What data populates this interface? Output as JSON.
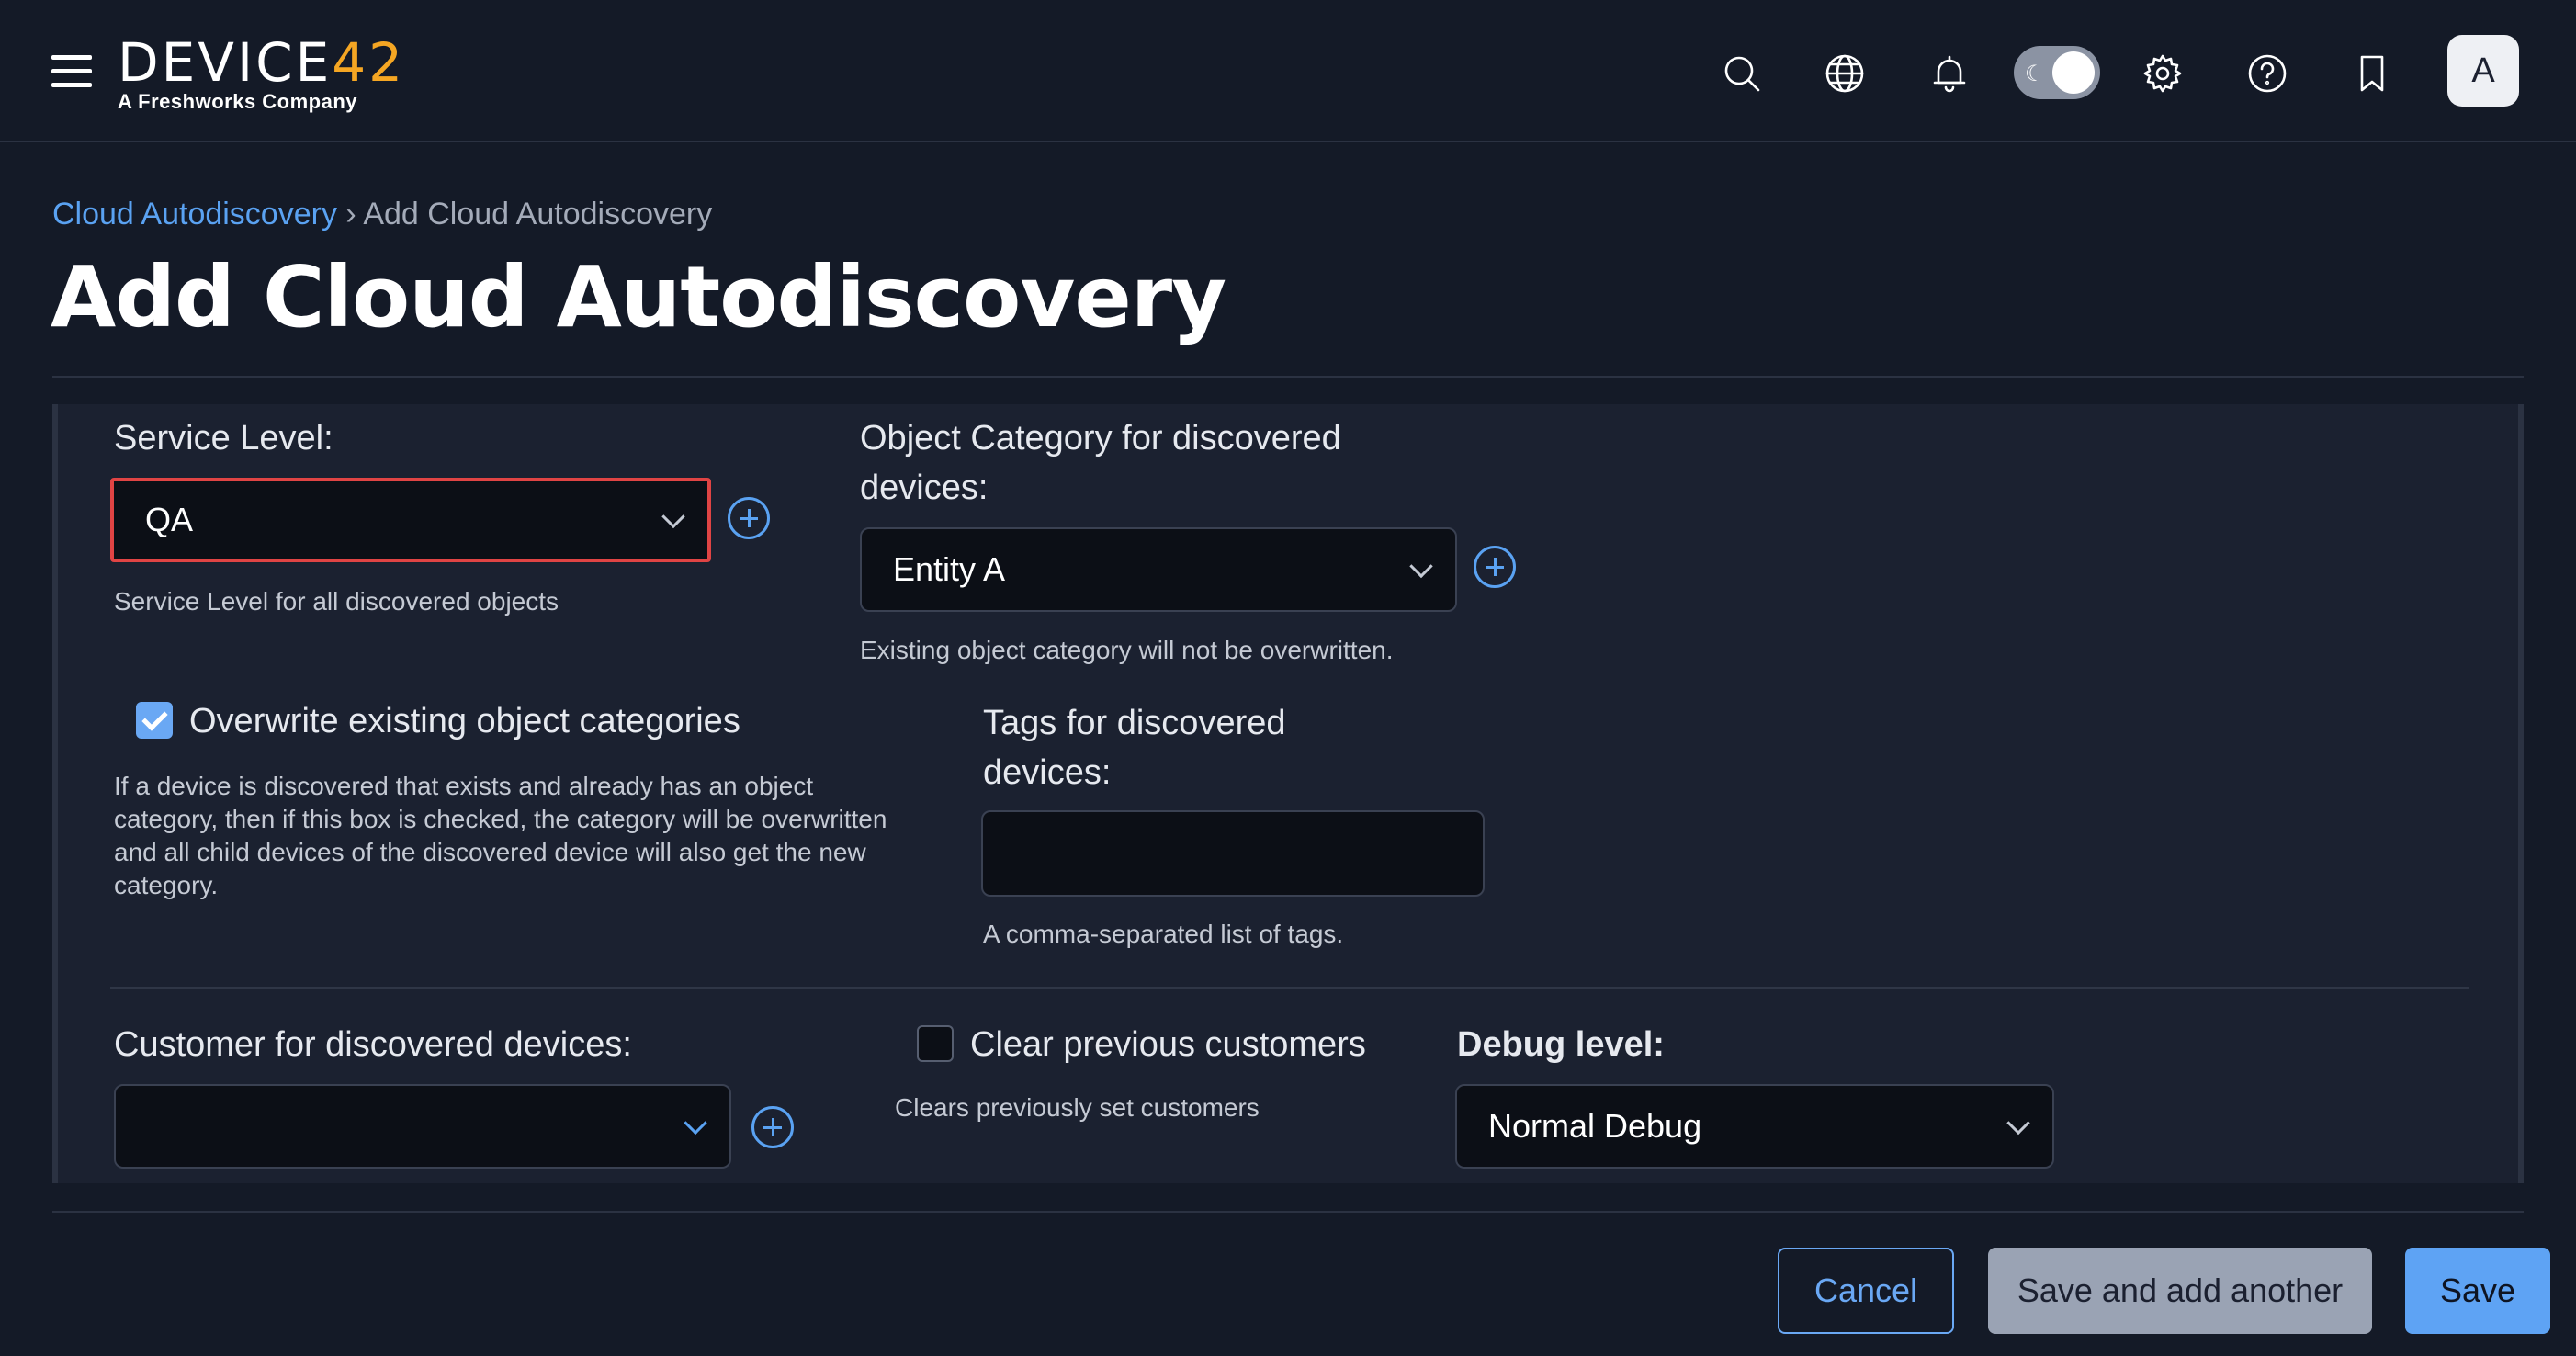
{
  "header": {
    "logo_text": "DEVICE",
    "logo_number": "42",
    "logo_subtitle": "A Freshworks Company",
    "theme_toggle_icon": "moon-icon",
    "avatar_initial": "A",
    "icons": [
      "menu-icon",
      "search-icon",
      "globe-icon",
      "bell-icon",
      "gear-icon",
      "help-icon",
      "bookmark-icon"
    ]
  },
  "breadcrumb": {
    "parent": "Cloud Autodiscovery",
    "separator": "›",
    "current": "Add Cloud Autodiscovery"
  },
  "page_title": "Add Cloud Autodiscovery",
  "form": {
    "service_level": {
      "label": "Service Level:",
      "value": "QA",
      "help": "Service Level for all discovered objects"
    },
    "object_category": {
      "label_line1": "Object Category for discovered",
      "label_line2": "devices:",
      "value": "Entity A",
      "help": "Existing object category will not be overwritten."
    },
    "overwrite_categories": {
      "label": "Overwrite existing object categories",
      "checked": true,
      "help_lines": [
        "If a device is discovered that exists and already has an object",
        "category, then if this box is checked, the category will be overwritten",
        "and all child devices of the discovered device will also get the new",
        "category."
      ]
    },
    "tags": {
      "label_line1": "Tags for discovered",
      "label_line2": "devices:",
      "value": "",
      "help": "A comma-separated list of tags."
    },
    "customer": {
      "label": "Customer for discovered devices:",
      "value": ""
    },
    "clear_customers": {
      "label": "Clear previous customers",
      "checked": false,
      "help": "Clears previously set customers"
    },
    "debug_level": {
      "label": "Debug level:",
      "value": "Normal Debug"
    }
  },
  "footer": {
    "cancel_label": "Cancel",
    "save_add_another_label": "Save and add another",
    "save_label": "Save"
  },
  "colors": {
    "background": "#141a27",
    "panel": "#1b2130",
    "accent": "#5aa2f2",
    "logo_accent": "#f5a623",
    "highlight_border": "#e04444"
  }
}
